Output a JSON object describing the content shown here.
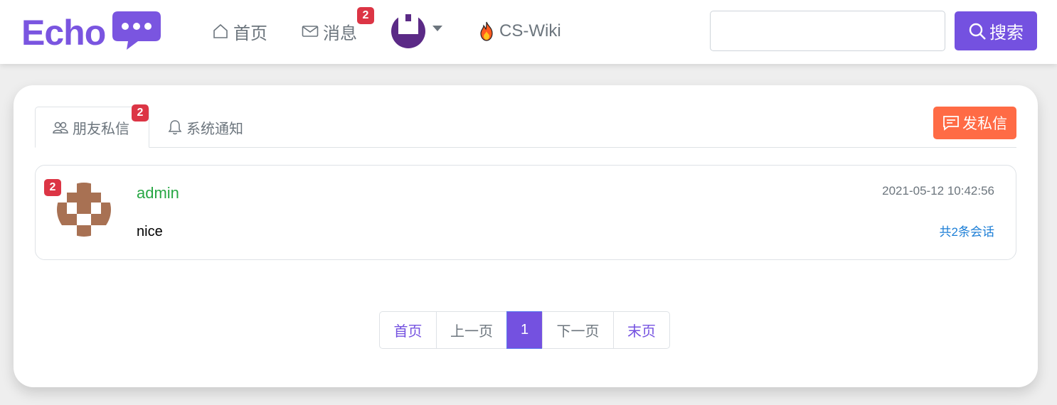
{
  "navbar": {
    "logo_text": "Echo",
    "home_label": "首页",
    "messages_label": "消息",
    "messages_badge": "2",
    "wiki_label": "CS-Wiki",
    "search_placeholder": "",
    "search_button": "搜索"
  },
  "tabs": {
    "friends_label": "朋友私信",
    "friends_badge": "2",
    "notice_label": "系统通知",
    "send_button": "发私信"
  },
  "conversations": [
    {
      "user": "admin",
      "badge": "2",
      "message": "nice",
      "time": "2021-05-12 10:42:56",
      "count_link": "共2条会话"
    }
  ],
  "pagination": {
    "first": "首页",
    "prev": "上一页",
    "current": "1",
    "next": "下一页",
    "last": "末页"
  },
  "colors": {
    "brand": "#7451e0",
    "danger": "#dc3545",
    "send": "#ff6b45",
    "username": "#28a745",
    "link": "#1c7ed6"
  },
  "icons": {
    "home": "home-icon",
    "messages": "envelope-icon",
    "wiki": "fire-icon",
    "search": "search-icon",
    "friends": "people-icon",
    "notice": "bell-icon",
    "send": "chat-icon"
  }
}
